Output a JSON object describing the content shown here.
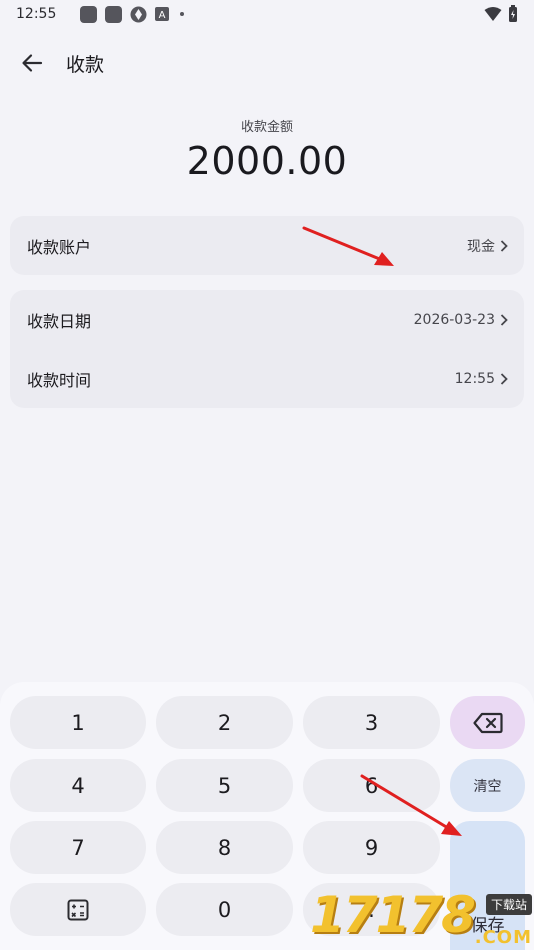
{
  "status_bar": {
    "time": "12:55",
    "icons": [
      "app-icon",
      "app-icon",
      "shield-icon",
      "text-icon",
      "dot-icon"
    ],
    "right_icons": [
      "wifi-icon",
      "battery-icon"
    ]
  },
  "app_bar": {
    "title": "收款"
  },
  "amount": {
    "label": "收款金额",
    "value": "2000.00"
  },
  "account_card": {
    "label": "收款账户",
    "value": "现金"
  },
  "datetime_card": {
    "date_label": "收款日期",
    "date_value": "2026-03-23",
    "time_label": "收款时间",
    "time_value": "12:55"
  },
  "keypad": {
    "keys": [
      "1",
      "2",
      "3",
      "4",
      "5",
      "6",
      "7",
      "8",
      "9",
      "0",
      "."
    ],
    "delete_icon": "backspace-icon",
    "calculator_icon": "calculator-icon",
    "clear_label": "清空",
    "save_label": "保存"
  },
  "watermark": {
    "digits": "17178",
    "tag": "下载站",
    "domain": ".COM"
  },
  "colors": {
    "background": "#f3f3f8",
    "card": "#ebebf1",
    "delete_key": "#ead9f3",
    "action_key": "#d6e3f6",
    "arrow": "#e02020"
  }
}
